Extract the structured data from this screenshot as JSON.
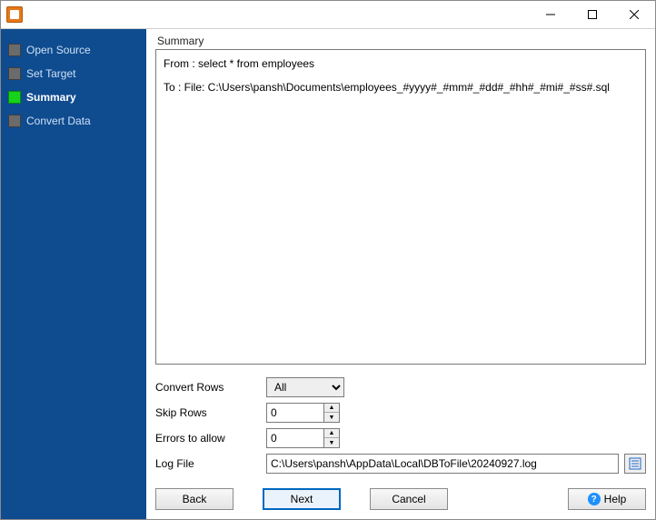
{
  "window": {
    "title": ""
  },
  "sidebar": {
    "steps": [
      {
        "label": "Open Source",
        "active": false
      },
      {
        "label": "Set Target",
        "active": false
      },
      {
        "label": "Summary",
        "active": true
      },
      {
        "label": "Convert Data",
        "active": false
      }
    ]
  },
  "main": {
    "section_label": "Summary",
    "summary": {
      "from_line": "From : select * from employees",
      "to_line": "To : File: C:\\Users\\pansh\\Documents\\employees_#yyyy#_#mm#_#dd#_#hh#_#mi#_#ss#.sql"
    },
    "form": {
      "convert_rows_label": "Convert Rows",
      "convert_rows_value": "All",
      "skip_rows_label": "Skip Rows",
      "skip_rows_value": "0",
      "errors_label": "Errors to allow",
      "errors_value": "0",
      "log_label": "Log File",
      "log_value": "C:\\Users\\pansh\\AppData\\Local\\DBToFile\\20240927.log"
    },
    "buttons": {
      "back": "Back",
      "next": "Next",
      "cancel": "Cancel",
      "help": "Help"
    }
  }
}
